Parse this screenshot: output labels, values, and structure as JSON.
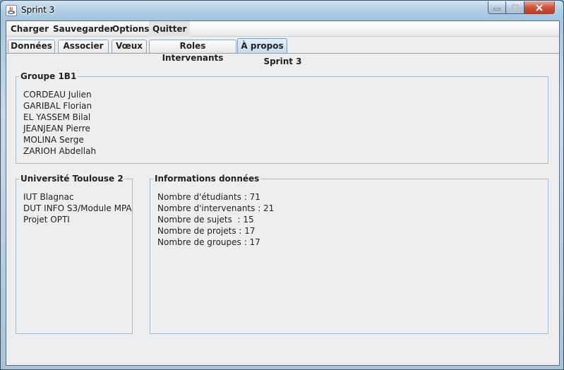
{
  "window": {
    "title": "Sprint 3"
  },
  "menubar": {
    "items": [
      "Charger",
      "Sauvegarder",
      "Options",
      "Quitter"
    ]
  },
  "tabs": [
    "Données",
    "Associer",
    "Vœux",
    "Roles Intervenants",
    "À propos"
  ],
  "active_tab": "À propos",
  "panel": {
    "title": "Sprint 3",
    "group": {
      "legend": "Groupe 1B1",
      "members": [
        "CORDEAU Julien",
        "GARIBAL Florian",
        "EL YASSEM Bilal",
        "JEANJEAN Pierre",
        "MOLINA Serge",
        "ZARIOH Abdellah"
      ]
    },
    "university": {
      "legend": "Université Toulouse 2",
      "lines": [
        "IUT Blagnac",
        "DUT INFO S3/Module MPA",
        "Projet OPTI"
      ]
    },
    "info": {
      "legend": "Informations données",
      "lines": [
        "Nombre d'étudiants : 71",
        "Nombre d'intervenants : 21",
        "Nombre de sujets  : 15",
        "Nombre de projets : 17",
        "Nombre de groupes : 17"
      ]
    }
  },
  "colors": {
    "client_bg": "#eeeeee",
    "active_tab": "#c4daef",
    "close_button": "#d2533b"
  }
}
